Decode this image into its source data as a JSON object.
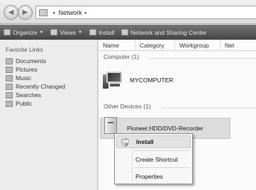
{
  "address": {
    "location": "Network",
    "separator": "▸"
  },
  "toolbar": {
    "items": [
      {
        "label": "Organize",
        "icon": "organize-icon"
      },
      {
        "label": "Views",
        "icon": "views-icon"
      },
      {
        "label": "Install",
        "icon": "install-icon"
      },
      {
        "label": "Network and Sharing Center",
        "icon": "network-center-icon"
      }
    ]
  },
  "sidebar": {
    "title": "Favorite Links",
    "items": [
      {
        "label": "Documents",
        "icon": "documents-icon"
      },
      {
        "label": "Pictures",
        "icon": "pictures-icon"
      },
      {
        "label": "Music",
        "icon": "music-icon"
      },
      {
        "label": "Recently Changed",
        "icon": "recent-icon"
      },
      {
        "label": "Searches",
        "icon": "searches-icon"
      },
      {
        "label": "Public",
        "icon": "public-icon"
      }
    ]
  },
  "columns": [
    "Name",
    "Category",
    "Workgroup",
    "Net"
  ],
  "groups": {
    "computer": {
      "header": "Computer (1)",
      "item": "MYCOMPUTER"
    },
    "other": {
      "header": "Other Devices (1)",
      "item": "Pioneer.HDD/DVD-Recorder"
    }
  },
  "context_menu": {
    "install": "Install",
    "create_shortcut": "Create Shortcut",
    "properties": "Properties"
  }
}
